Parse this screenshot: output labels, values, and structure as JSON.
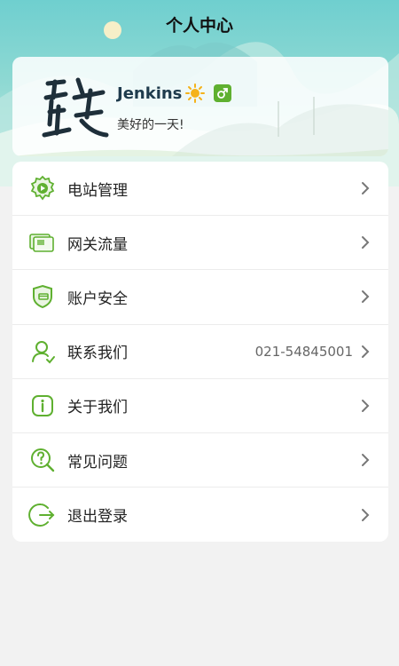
{
  "header": {
    "title": "个人中心"
  },
  "profile": {
    "username": "Jenkins",
    "motto": "美好的一天!",
    "avatar_icon": "signature-avatar-icon",
    "weather_icon": "sun-icon",
    "gender_icon": "male-icon"
  },
  "menu": {
    "items": [
      {
        "label": "电站管理",
        "icon": "power-station-gear-icon"
      },
      {
        "label": "网关流量",
        "icon": "gateway-cards-icon"
      },
      {
        "label": "账户安全",
        "icon": "shield-icon"
      },
      {
        "label": "联系我们",
        "icon": "contact-person-icon",
        "value": "021-54845001"
      },
      {
        "label": "关于我们",
        "icon": "info-icon"
      },
      {
        "label": "常见问题",
        "icon": "question-search-icon"
      },
      {
        "label": "退出登录",
        "icon": "logout-icon"
      }
    ]
  },
  "colors": {
    "accent_green": "#5fb030",
    "header_teal": "#6fcfcf",
    "background": "#f2f2f2"
  }
}
